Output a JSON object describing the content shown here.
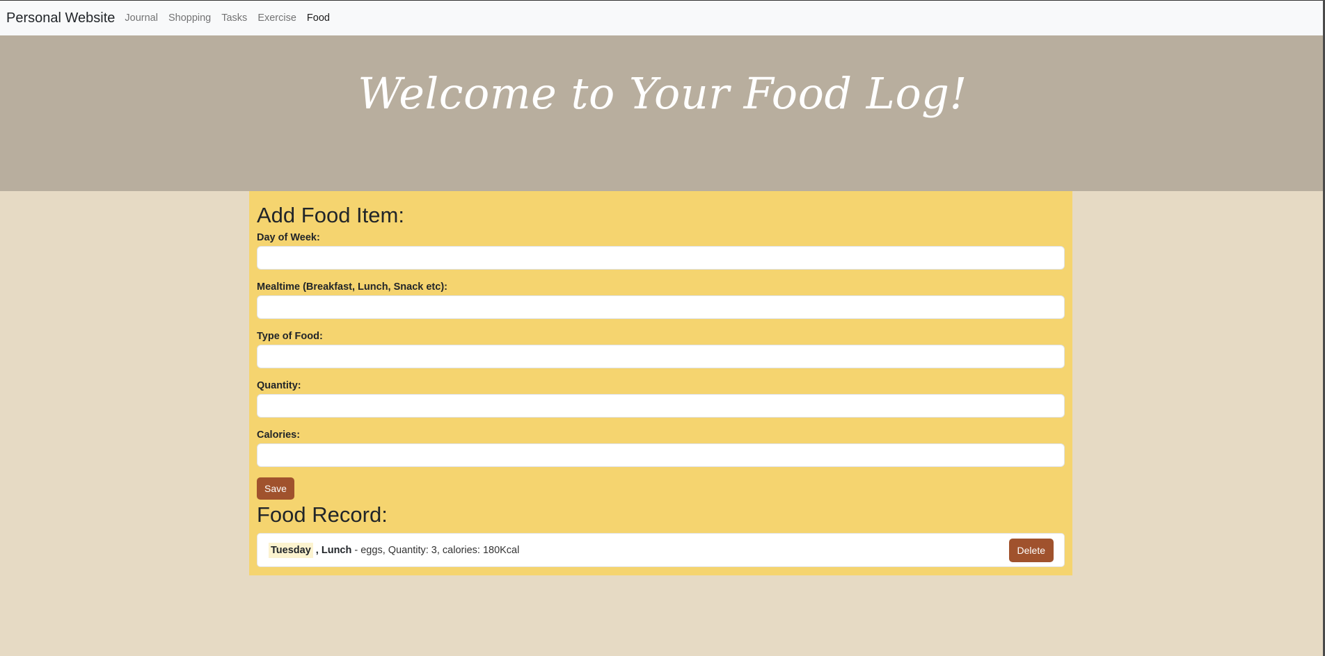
{
  "navbar": {
    "brand": "Personal Website",
    "links": [
      {
        "label": "Journal",
        "active": false
      },
      {
        "label": "Shopping",
        "active": false
      },
      {
        "label": "Tasks",
        "active": false
      },
      {
        "label": "Exercise",
        "active": false
      },
      {
        "label": "Food",
        "active": true
      }
    ]
  },
  "hero": {
    "title": "Welcome to Your Food Log!"
  },
  "form": {
    "title": "Add Food Item:",
    "fields": [
      {
        "label": "Day of Week:",
        "value": ""
      },
      {
        "label": "Mealtime (Breakfast, Lunch, Snack etc):",
        "value": ""
      },
      {
        "label": "Type of Food:",
        "value": ""
      },
      {
        "label": "Quantity:",
        "value": ""
      },
      {
        "label": "Calories:",
        "value": ""
      }
    ],
    "save_label": "Save"
  },
  "record": {
    "title": "Food Record:",
    "items": [
      {
        "day": "Tuesday",
        "separator": " , ",
        "meal": "Lunch",
        "details": " - eggs, Quantity: 3, calories: 180Kcal",
        "delete_label": "Delete"
      }
    ]
  },
  "colors": {
    "navbar_bg": "#f8f9fa",
    "hero_bg": "#b8ae9e",
    "page_bg": "#e6dac4",
    "panel_bg": "#f5d46f",
    "button_bg": "#a0522d"
  }
}
